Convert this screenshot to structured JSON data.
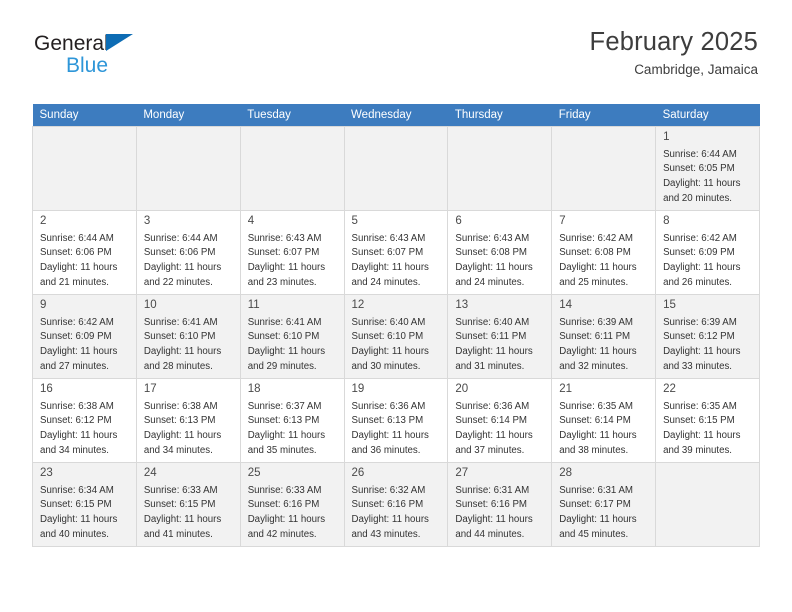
{
  "logo": {
    "word1": "General",
    "word2": "Blue",
    "triangle_color": "#0d6cb4",
    "word2_color": "#2e96d8"
  },
  "header": {
    "title": "February 2025",
    "subtitle": "Cambridge, Jamaica",
    "accent_color": "#3d7cbf"
  },
  "weekday_headers": [
    "Sunday",
    "Monday",
    "Tuesday",
    "Wednesday",
    "Thursday",
    "Friday",
    "Saturday"
  ],
  "weeks": [
    {
      "shaded": true,
      "days": [
        {
          "empty": true
        },
        {
          "empty": true
        },
        {
          "empty": true
        },
        {
          "empty": true
        },
        {
          "empty": true
        },
        {
          "empty": true
        },
        {
          "num": "1",
          "sunrise": "Sunrise: 6:44 AM",
          "sunset": "Sunset: 6:05 PM",
          "daylight": "Daylight: 11 hours and 20 minutes."
        }
      ]
    },
    {
      "shaded": false,
      "days": [
        {
          "num": "2",
          "sunrise": "Sunrise: 6:44 AM",
          "sunset": "Sunset: 6:06 PM",
          "daylight": "Daylight: 11 hours and 21 minutes."
        },
        {
          "num": "3",
          "sunrise": "Sunrise: 6:44 AM",
          "sunset": "Sunset: 6:06 PM",
          "daylight": "Daylight: 11 hours and 22 minutes."
        },
        {
          "num": "4",
          "sunrise": "Sunrise: 6:43 AM",
          "sunset": "Sunset: 6:07 PM",
          "daylight": "Daylight: 11 hours and 23 minutes."
        },
        {
          "num": "5",
          "sunrise": "Sunrise: 6:43 AM",
          "sunset": "Sunset: 6:07 PM",
          "daylight": "Daylight: 11 hours and 24 minutes."
        },
        {
          "num": "6",
          "sunrise": "Sunrise: 6:43 AM",
          "sunset": "Sunset: 6:08 PM",
          "daylight": "Daylight: 11 hours and 24 minutes."
        },
        {
          "num": "7",
          "sunrise": "Sunrise: 6:42 AM",
          "sunset": "Sunset: 6:08 PM",
          "daylight": "Daylight: 11 hours and 25 minutes."
        },
        {
          "num": "8",
          "sunrise": "Sunrise: 6:42 AM",
          "sunset": "Sunset: 6:09 PM",
          "daylight": "Daylight: 11 hours and 26 minutes."
        }
      ]
    },
    {
      "shaded": true,
      "days": [
        {
          "num": "9",
          "sunrise": "Sunrise: 6:42 AM",
          "sunset": "Sunset: 6:09 PM",
          "daylight": "Daylight: 11 hours and 27 minutes."
        },
        {
          "num": "10",
          "sunrise": "Sunrise: 6:41 AM",
          "sunset": "Sunset: 6:10 PM",
          "daylight": "Daylight: 11 hours and 28 minutes."
        },
        {
          "num": "11",
          "sunrise": "Sunrise: 6:41 AM",
          "sunset": "Sunset: 6:10 PM",
          "daylight": "Daylight: 11 hours and 29 minutes."
        },
        {
          "num": "12",
          "sunrise": "Sunrise: 6:40 AM",
          "sunset": "Sunset: 6:10 PM",
          "daylight": "Daylight: 11 hours and 30 minutes."
        },
        {
          "num": "13",
          "sunrise": "Sunrise: 6:40 AM",
          "sunset": "Sunset: 6:11 PM",
          "daylight": "Daylight: 11 hours and 31 minutes."
        },
        {
          "num": "14",
          "sunrise": "Sunrise: 6:39 AM",
          "sunset": "Sunset: 6:11 PM",
          "daylight": "Daylight: 11 hours and 32 minutes."
        },
        {
          "num": "15",
          "sunrise": "Sunrise: 6:39 AM",
          "sunset": "Sunset: 6:12 PM",
          "daylight": "Daylight: 11 hours and 33 minutes."
        }
      ]
    },
    {
      "shaded": false,
      "days": [
        {
          "num": "16",
          "sunrise": "Sunrise: 6:38 AM",
          "sunset": "Sunset: 6:12 PM",
          "daylight": "Daylight: 11 hours and 34 minutes."
        },
        {
          "num": "17",
          "sunrise": "Sunrise: 6:38 AM",
          "sunset": "Sunset: 6:13 PM",
          "daylight": "Daylight: 11 hours and 34 minutes."
        },
        {
          "num": "18",
          "sunrise": "Sunrise: 6:37 AM",
          "sunset": "Sunset: 6:13 PM",
          "daylight": "Daylight: 11 hours and 35 minutes."
        },
        {
          "num": "19",
          "sunrise": "Sunrise: 6:36 AM",
          "sunset": "Sunset: 6:13 PM",
          "daylight": "Daylight: 11 hours and 36 minutes."
        },
        {
          "num": "20",
          "sunrise": "Sunrise: 6:36 AM",
          "sunset": "Sunset: 6:14 PM",
          "daylight": "Daylight: 11 hours and 37 minutes."
        },
        {
          "num": "21",
          "sunrise": "Sunrise: 6:35 AM",
          "sunset": "Sunset: 6:14 PM",
          "daylight": "Daylight: 11 hours and 38 minutes."
        },
        {
          "num": "22",
          "sunrise": "Sunrise: 6:35 AM",
          "sunset": "Sunset: 6:15 PM",
          "daylight": "Daylight: 11 hours and 39 minutes."
        }
      ]
    },
    {
      "shaded": true,
      "days": [
        {
          "num": "23",
          "sunrise": "Sunrise: 6:34 AM",
          "sunset": "Sunset: 6:15 PM",
          "daylight": "Daylight: 11 hours and 40 minutes."
        },
        {
          "num": "24",
          "sunrise": "Sunrise: 6:33 AM",
          "sunset": "Sunset: 6:15 PM",
          "daylight": "Daylight: 11 hours and 41 minutes."
        },
        {
          "num": "25",
          "sunrise": "Sunrise: 6:33 AM",
          "sunset": "Sunset: 6:16 PM",
          "daylight": "Daylight: 11 hours and 42 minutes."
        },
        {
          "num": "26",
          "sunrise": "Sunrise: 6:32 AM",
          "sunset": "Sunset: 6:16 PM",
          "daylight": "Daylight: 11 hours and 43 minutes."
        },
        {
          "num": "27",
          "sunrise": "Sunrise: 6:31 AM",
          "sunset": "Sunset: 6:16 PM",
          "daylight": "Daylight: 11 hours and 44 minutes."
        },
        {
          "num": "28",
          "sunrise": "Sunrise: 6:31 AM",
          "sunset": "Sunset: 6:17 PM",
          "daylight": "Daylight: 11 hours and 45 minutes."
        },
        {
          "empty": true
        }
      ]
    }
  ]
}
